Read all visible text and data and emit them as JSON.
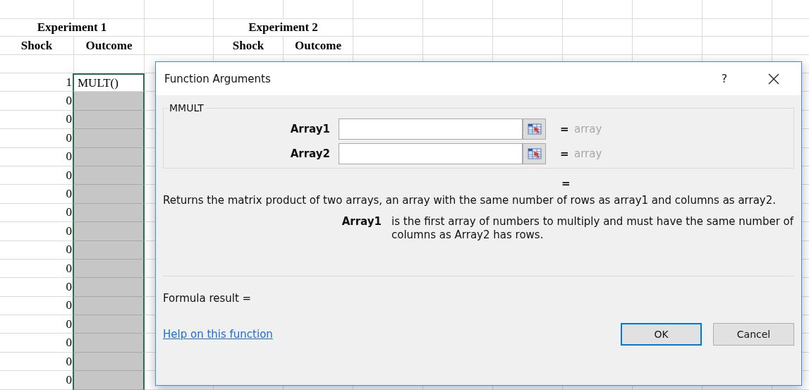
{
  "sheet": {
    "groups": [
      {
        "title": "Experiment 1"
      },
      {
        "title": "Experiment 2"
      }
    ],
    "column_headers": [
      "Shock",
      "Outcome",
      "Shock",
      "Outcome"
    ],
    "rows": [
      {
        "shock": "1",
        "outcome": "MULT()",
        "selected": true,
        "active": true
      },
      {
        "shock": "0",
        "selected": true,
        "active": false
      },
      {
        "shock": "0",
        "selected": true,
        "active": false
      },
      {
        "shock": "0",
        "selected": true,
        "active": false
      },
      {
        "shock": "0",
        "selected": true,
        "active": false
      },
      {
        "shock": "0",
        "selected": true,
        "active": false
      },
      {
        "shock": "0",
        "selected": true,
        "active": false
      },
      {
        "shock": "0",
        "selected": true,
        "active": false
      },
      {
        "shock": "0",
        "selected": true,
        "active": false
      },
      {
        "shock": "0",
        "selected": true,
        "active": false
      },
      {
        "shock": "0",
        "selected": true,
        "active": false
      },
      {
        "shock": "0",
        "selected": true,
        "active": false
      },
      {
        "shock": "0",
        "selected": true,
        "active": false
      },
      {
        "shock": "0",
        "selected": true,
        "active": false
      },
      {
        "shock": "0",
        "selected": true,
        "active": false
      },
      {
        "shock": "0",
        "selected": true,
        "active": false
      },
      {
        "shock": "0",
        "selected": true,
        "active": false
      }
    ]
  },
  "dialog": {
    "title": "Function Arguments",
    "help_glyph": "?",
    "function_name": "MMULT",
    "arguments": [
      {
        "label": "Array1",
        "equals": "=",
        "result": "array"
      },
      {
        "label": "Array2",
        "equals": "=",
        "result": "array"
      }
    ],
    "total_equals": "=",
    "description": "Returns the matrix product of two arrays, an array with the same number of rows as array1 and columns as array2.",
    "argument_help": {
      "name": "Array1",
      "text": "is the first array of numbers to multiply and must have the same number of columns as Array2 has rows."
    },
    "formula_result": "Formula result =",
    "help_link": "Help on this function",
    "buttons": [
      {
        "label": "OK",
        "default": true
      },
      {
        "label": "Cancel",
        "default": false
      }
    ]
  }
}
